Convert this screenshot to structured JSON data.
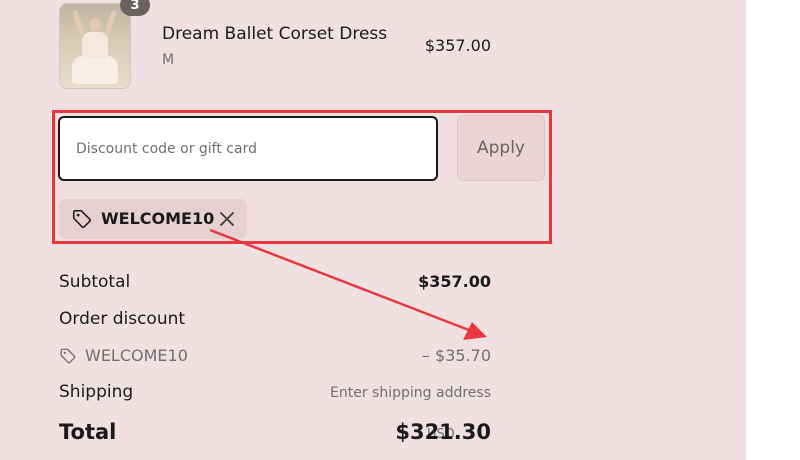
{
  "product": {
    "quantity_badge": "3",
    "title": "Dream Ballet Corset Dress",
    "variant": "M",
    "price": "$357.00"
  },
  "discount": {
    "placeholder": "Discount code or gift card",
    "value": "",
    "apply_label": "Apply",
    "applied_code": "WELCOME10",
    "tag_icon": "tag-icon",
    "remove_icon": "close-icon"
  },
  "summary": {
    "subtotal_label": "Subtotal",
    "subtotal_value": "$357.00",
    "order_discount_label": "Order discount",
    "discount_code": "WELCOME10",
    "discount_amount": "– $35.70",
    "shipping_label": "Shipping",
    "shipping_value": "Enter shipping address",
    "total_label": "Total",
    "total_currency": "USD",
    "total_value": "$321.30"
  },
  "annotation": {
    "highlight_color": "#e8373f",
    "arrow_color": "#e8373f"
  },
  "colors": {
    "panel_background": "#f1e0e1",
    "chip_background": "#e6d0d2",
    "button_background": "#ead4d6",
    "muted_text": "#707070"
  }
}
